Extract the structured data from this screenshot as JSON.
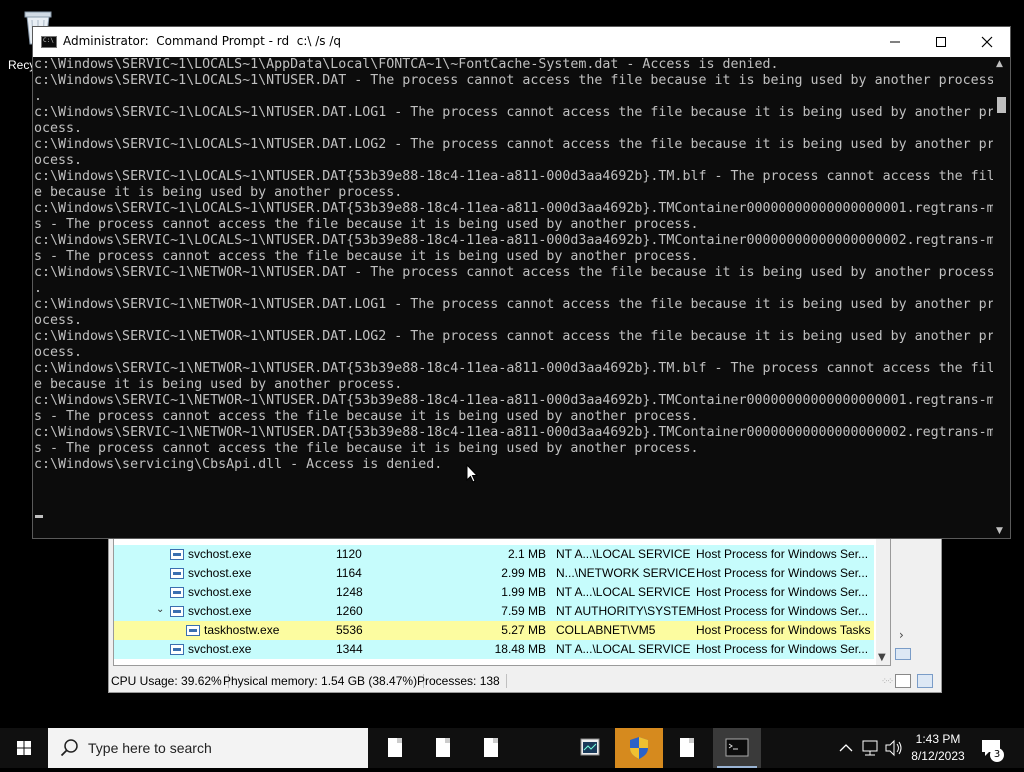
{
  "desktop": {
    "recycle_bin_label": "Recyc"
  },
  "process_explorer": {
    "rows": [
      {
        "name": "svchost.exe",
        "pid": "1120",
        "mem": "2.1 MB",
        "user": "NT A...\\LOCAL SERVICE",
        "desc": "Host Process for Windows Ser...",
        "highlight": false,
        "indent": 0,
        "tree": ""
      },
      {
        "name": "svchost.exe",
        "pid": "1164",
        "mem": "2.99 MB",
        "user": "N...\\NETWORK SERVICE",
        "desc": "Host Process for Windows Ser...",
        "highlight": false,
        "indent": 0,
        "tree": ""
      },
      {
        "name": "svchost.exe",
        "pid": "1248",
        "mem": "1.99 MB",
        "user": "NT A...\\LOCAL SERVICE",
        "desc": "Host Process for Windows Ser...",
        "highlight": false,
        "indent": 0,
        "tree": ""
      },
      {
        "name": "svchost.exe",
        "pid": "1260",
        "mem": "7.59 MB",
        "user": "NT AUTHORITY\\SYSTEM",
        "desc": "Host Process for Windows Ser...",
        "highlight": false,
        "indent": 0,
        "tree": "⌄"
      },
      {
        "name": "taskhostw.exe",
        "pid": "5536",
        "mem": "5.27 MB",
        "user": "COLLABNET\\VM5",
        "desc": "Host Process for Windows Tasks",
        "highlight": true,
        "indent": 1,
        "tree": ""
      },
      {
        "name": "svchost.exe",
        "pid": "1344",
        "mem": "18.48 MB",
        "user": "NT A...\\LOCAL SERVICE",
        "desc": "Host Process for Windows Ser...",
        "highlight": false,
        "indent": 0,
        "tree": ""
      }
    ],
    "status": {
      "cpu": "CPU Usage: 39.62%",
      "memory": "Physical memory: 1.54 GB (38.47%)",
      "processes": "Processes: 138"
    }
  },
  "cmd": {
    "title": "Administrator:  Command Prompt - rd  c:\\ /s /q",
    "lines": [
      "c:\\Windows\\SERVIC~1\\LOCALS~1\\AppData\\Local\\FONTCA~1\\~FontCache-System.dat - Access is denied.",
      "c:\\Windows\\SERVIC~1\\LOCALS~1\\NTUSER.DAT - The process cannot access the file because it is being used by another process",
      ".",
      "c:\\Windows\\SERVIC~1\\LOCALS~1\\NTUSER.DAT.LOG1 - The process cannot access the file because it is being used by another pr",
      "ocess.",
      "c:\\Windows\\SERVIC~1\\LOCALS~1\\NTUSER.DAT.LOG2 - The process cannot access the file because it is being used by another pr",
      "ocess.",
      "c:\\Windows\\SERVIC~1\\LOCALS~1\\NTUSER.DAT{53b39e88-18c4-11ea-a811-000d3aa4692b}.TM.blf - The process cannot access the fil",
      "e because it is being used by another process.",
      "c:\\Windows\\SERVIC~1\\LOCALS~1\\NTUSER.DAT{53b39e88-18c4-11ea-a811-000d3aa4692b}.TMContainer00000000000000000001.regtrans-m",
      "s - The process cannot access the file because it is being used by another process.",
      "c:\\Windows\\SERVIC~1\\LOCALS~1\\NTUSER.DAT{53b39e88-18c4-11ea-a811-000d3aa4692b}.TMContainer00000000000000000002.regtrans-m",
      "s - The process cannot access the file because it is being used by another process.",
      "c:\\Windows\\SERVIC~1\\NETWOR~1\\NTUSER.DAT - The process cannot access the file because it is being used by another process",
      ".",
      "c:\\Windows\\SERVIC~1\\NETWOR~1\\NTUSER.DAT.LOG1 - The process cannot access the file because it is being used by another pr",
      "ocess.",
      "c:\\Windows\\SERVIC~1\\NETWOR~1\\NTUSER.DAT.LOG2 - The process cannot access the file because it is being used by another pr",
      "ocess.",
      "c:\\Windows\\SERVIC~1\\NETWOR~1\\NTUSER.DAT{53b39e88-18c4-11ea-a811-000d3aa4692b}.TM.blf - The process cannot access the fil",
      "e because it is being used by another process.",
      "c:\\Windows\\SERVIC~1\\NETWOR~1\\NTUSER.DAT{53b39e88-18c4-11ea-a811-000d3aa4692b}.TMContainer00000000000000000001.regtrans-m",
      "s - The process cannot access the file because it is being used by another process.",
      "c:\\Windows\\SERVIC~1\\NETWOR~1\\NTUSER.DAT{53b39e88-18c4-11ea-a811-000d3aa4692b}.TMContainer00000000000000000002.regtrans-m",
      "s - The process cannot access the file because it is being used by another process.",
      "c:\\Windows\\servicing\\CbsApi.dll - Access is denied."
    ]
  },
  "taskbar": {
    "search_placeholder": "Type here to search",
    "time": "1:43 PM",
    "date": "8/12/2023",
    "notification_count": "3"
  }
}
